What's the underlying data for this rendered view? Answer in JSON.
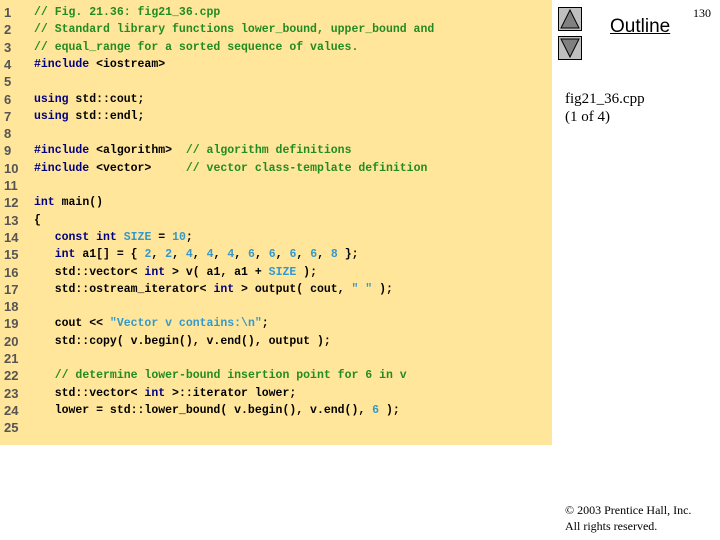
{
  "slide": {
    "page_number": "130",
    "outline_label": "Outline",
    "file_name": "fig21_36.cpp",
    "file_part": "(1 of 4)",
    "copyright_line1": "© 2003 Prentice Hall, Inc.",
    "copyright_line2": "All rights reserved.",
    "nav": {
      "up_icon": "triangle-up-icon",
      "down_icon": "triangle-down-icon"
    }
  },
  "colors": {
    "panel_bg": "#ffe69a",
    "keyword": "#000080",
    "comment": "#228b22",
    "literal": "#3399cc",
    "line_number": "#555555"
  },
  "code": {
    "lines": [
      {
        "n": "1",
        "tokens": [
          {
            "t": "cm",
            "v": "// Fig. 21.36: fig21_36.cpp"
          }
        ]
      },
      {
        "n": "2",
        "tokens": [
          {
            "t": "cm",
            "v": "// Standard library functions lower_bound, upper_bound and"
          }
        ]
      },
      {
        "n": "3",
        "tokens": [
          {
            "t": "cm",
            "v": "// equal_range for a sorted sequence of values."
          }
        ]
      },
      {
        "n": "4",
        "tokens": [
          {
            "t": "kw",
            "v": "#include"
          },
          {
            "t": "tx",
            "v": " <iostream>"
          }
        ]
      },
      {
        "n": "5",
        "tokens": []
      },
      {
        "n": "6",
        "tokens": [
          {
            "t": "kw",
            "v": "using"
          },
          {
            "t": "tx",
            "v": " std::cout;"
          }
        ]
      },
      {
        "n": "7",
        "tokens": [
          {
            "t": "kw",
            "v": "using"
          },
          {
            "t": "tx",
            "v": " std::endl;"
          }
        ]
      },
      {
        "n": "8",
        "tokens": []
      },
      {
        "n": "9",
        "tokens": [
          {
            "t": "kw",
            "v": "#include"
          },
          {
            "t": "tx",
            "v": " <algorithm>  "
          },
          {
            "t": "cm",
            "v": "// algorithm definitions"
          }
        ]
      },
      {
        "n": "10",
        "tokens": [
          {
            "t": "kw",
            "v": "#include"
          },
          {
            "t": "tx",
            "v": " <vector>     "
          },
          {
            "t": "cm",
            "v": "// vector class-template definition"
          }
        ]
      },
      {
        "n": "11",
        "tokens": []
      },
      {
        "n": "12",
        "tokens": [
          {
            "t": "kw",
            "v": "int"
          },
          {
            "t": "tx",
            "v": " main()"
          }
        ]
      },
      {
        "n": "13",
        "tokens": [
          {
            "t": "tx",
            "v": "{"
          }
        ]
      },
      {
        "n": "14",
        "tokens": [
          {
            "t": "tx",
            "v": "   "
          },
          {
            "t": "kw",
            "v": "const int"
          },
          {
            "t": "tx",
            "v": " "
          },
          {
            "t": "lit",
            "v": "SIZE"
          },
          {
            "t": "tx",
            "v": " = "
          },
          {
            "t": "lit",
            "v": "10"
          },
          {
            "t": "tx",
            "v": ";"
          }
        ]
      },
      {
        "n": "15",
        "tokens": [
          {
            "t": "tx",
            "v": "   "
          },
          {
            "t": "kw",
            "v": "int"
          },
          {
            "t": "tx",
            "v": " a1[] = { "
          },
          {
            "t": "lit",
            "v": "2"
          },
          {
            "t": "tx",
            "v": ", "
          },
          {
            "t": "lit",
            "v": "2"
          },
          {
            "t": "tx",
            "v": ", "
          },
          {
            "t": "lit",
            "v": "4"
          },
          {
            "t": "tx",
            "v": ", "
          },
          {
            "t": "lit",
            "v": "4"
          },
          {
            "t": "tx",
            "v": ", "
          },
          {
            "t": "lit",
            "v": "4"
          },
          {
            "t": "tx",
            "v": ", "
          },
          {
            "t": "lit",
            "v": "6"
          },
          {
            "t": "tx",
            "v": ", "
          },
          {
            "t": "lit",
            "v": "6"
          },
          {
            "t": "tx",
            "v": ", "
          },
          {
            "t": "lit",
            "v": "6"
          },
          {
            "t": "tx",
            "v": ", "
          },
          {
            "t": "lit",
            "v": "6"
          },
          {
            "t": "tx",
            "v": ", "
          },
          {
            "t": "lit",
            "v": "8"
          },
          {
            "t": "tx",
            "v": " };"
          }
        ]
      },
      {
        "n": "16",
        "tokens": [
          {
            "t": "tx",
            "v": "   std::vector< "
          },
          {
            "t": "kw",
            "v": "int"
          },
          {
            "t": "tx",
            "v": " > v( a1, a1 + "
          },
          {
            "t": "lit",
            "v": "SIZE"
          },
          {
            "t": "tx",
            "v": " );"
          }
        ]
      },
      {
        "n": "17",
        "tokens": [
          {
            "t": "tx",
            "v": "   std::ostream_iterator< "
          },
          {
            "t": "kw",
            "v": "int"
          },
          {
            "t": "tx",
            "v": " > output( cout, "
          },
          {
            "t": "lit",
            "v": "\" \""
          },
          {
            "t": "tx",
            "v": " );"
          }
        ]
      },
      {
        "n": "18",
        "tokens": []
      },
      {
        "n": "19",
        "tokens": [
          {
            "t": "tx",
            "v": "   cout << "
          },
          {
            "t": "lit",
            "v": "\"Vector v contains:\\n\""
          },
          {
            "t": "tx",
            "v": ";"
          }
        ]
      },
      {
        "n": "20",
        "tokens": [
          {
            "t": "tx",
            "v": "   std::copy( v.begin(), v.end(), output );"
          }
        ]
      },
      {
        "n": "21",
        "tokens": []
      },
      {
        "n": "22",
        "tokens": [
          {
            "t": "tx",
            "v": "   "
          },
          {
            "t": "cm",
            "v": "// determine lower-bound insertion point for 6 in v"
          }
        ]
      },
      {
        "n": "23",
        "tokens": [
          {
            "t": "tx",
            "v": "   std::vector< "
          },
          {
            "t": "kw",
            "v": "int"
          },
          {
            "t": "tx",
            "v": " >::iterator lower;"
          }
        ]
      },
      {
        "n": "24",
        "tokens": [
          {
            "t": "tx",
            "v": "   lower = std::lower_bound( v.begin(), v.end(), "
          },
          {
            "t": "lit",
            "v": "6"
          },
          {
            "t": "tx",
            "v": " );"
          }
        ]
      },
      {
        "n": "25",
        "tokens": []
      }
    ]
  }
}
